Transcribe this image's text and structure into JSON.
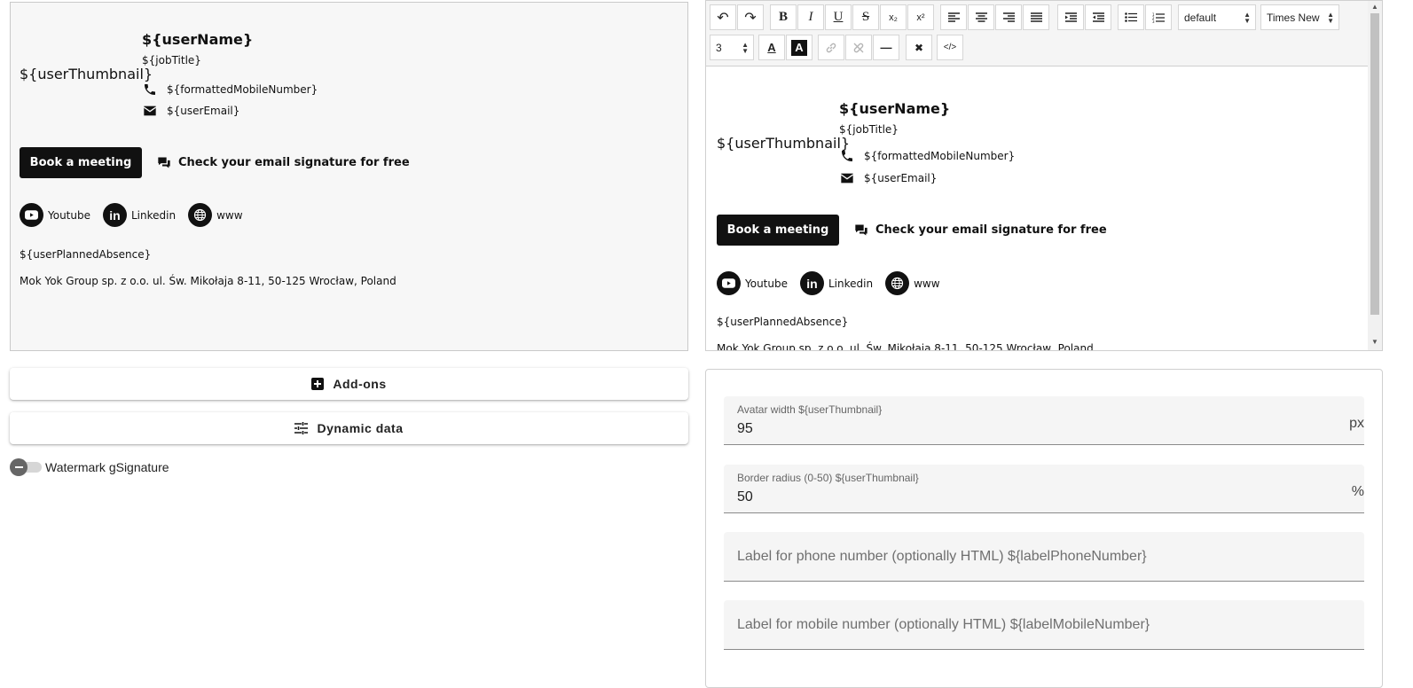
{
  "signature": {
    "thumbnail": "${userThumbnail}",
    "user_name": "${userName}",
    "job_title": "${jobTitle}",
    "mobile": "${formattedMobileNumber}",
    "email": "${userEmail}",
    "book_button": "Book a meeting",
    "check_link": "Check your email signature for free",
    "socials": [
      {
        "label": "Youtube",
        "icon": "youtube-icon"
      },
      {
        "label": "Linkedin",
        "icon": "linkedin-icon"
      },
      {
        "label": "www",
        "icon": "globe-icon"
      }
    ],
    "planned_absence": "${userPlannedAbsence}",
    "address": "Mok Yok Group sp. z o.o. ul. Św. Mikołaja 8-11, 50-125 Wrocław, Poland"
  },
  "left_panel": {
    "addons_label": "Add-ons",
    "dynamic_label": "Dynamic data",
    "watermark_label": "Watermark gSignature",
    "watermark_on": false
  },
  "editor": {
    "toolbar": {
      "undo": "↶",
      "redo": "↷",
      "bold": "B",
      "italic": "I",
      "underline": "U",
      "strike": "S",
      "subscript": "x₂",
      "superscript": "x²",
      "format_select": "default",
      "font_select": "Times New Roman",
      "size_select": "3",
      "text_color": "A",
      "bg_color": "A",
      "hr": "—",
      "clear": "✖",
      "code": "</>"
    }
  },
  "settings": {
    "fields": [
      {
        "label": "Avatar width ${userThumbnail}",
        "value": "95",
        "suffix": "px"
      },
      {
        "label": "Border radius (0-50) ${userThumbnail}",
        "value": "50",
        "suffix": "%"
      },
      {
        "placeholder": "Label for phone number (optionally HTML) ${labelPhoneNumber}"
      },
      {
        "placeholder": "Label for mobile number (optionally HTML) ${labelMobileNumber}"
      }
    ]
  }
}
